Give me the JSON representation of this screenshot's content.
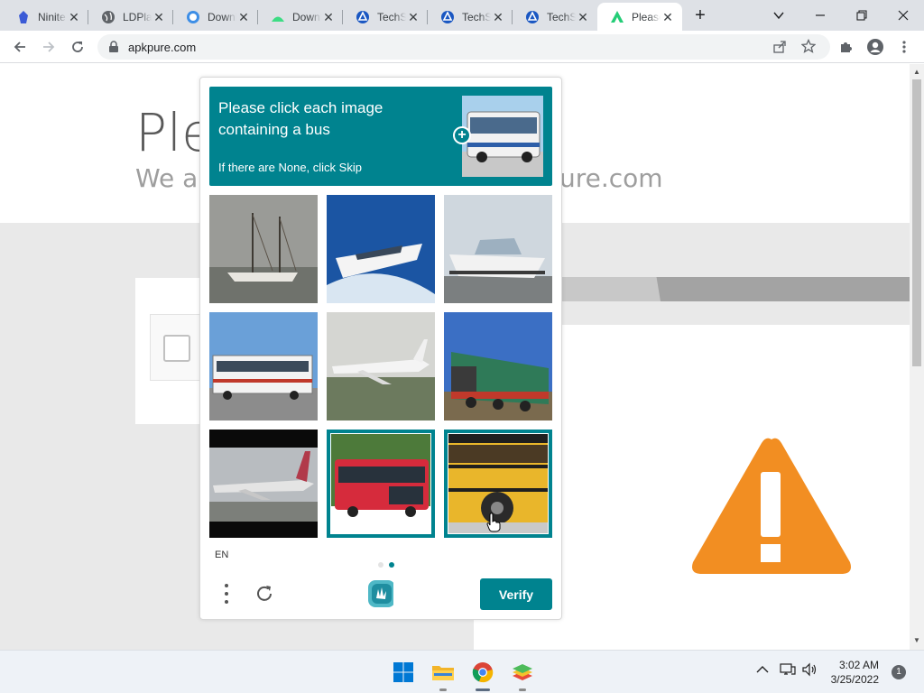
{
  "browser": {
    "tabs": [
      {
        "title": "Ninite",
        "icon": "ninite-icon",
        "active": false
      },
      {
        "title": "LDPlayer",
        "icon": "globe-icon",
        "active": false
      },
      {
        "title": "Download",
        "icon": "download-site-icon",
        "active": false
      },
      {
        "title": "Download",
        "icon": "android-icon",
        "active": false
      },
      {
        "title": "TechSpot",
        "icon": "techspot-icon",
        "active": false
      },
      {
        "title": "TechSpot",
        "icon": "techspot-icon",
        "active": false
      },
      {
        "title": "TechSpot",
        "icon": "techspot-icon",
        "active": false
      },
      {
        "title": "Please",
        "icon": "apkpure-icon",
        "active": true
      }
    ],
    "url": "apkpure.com"
  },
  "page": {
    "heading": "Ple",
    "subtitle_left": "We ar",
    "subtitle_right": "ure.com"
  },
  "captcha": {
    "prompt_line": "Please click each image containing a bus",
    "skip_hint": "If there are None, click Skip",
    "tiles": [
      {
        "subject": "sailboat",
        "selected": false
      },
      {
        "subject": "yacht",
        "selected": false
      },
      {
        "subject": "speedboat",
        "selected": false
      },
      {
        "subject": "bus",
        "selected": false
      },
      {
        "subject": "jet",
        "selected": false
      },
      {
        "subject": "train",
        "selected": false
      },
      {
        "subject": "airliner",
        "selected": false
      },
      {
        "subject": "red-bus",
        "selected": true
      },
      {
        "subject": "school-bus",
        "selected": true
      }
    ],
    "language": "EN",
    "verify_label": "Verify",
    "accent_color": "#00838f"
  },
  "taskbar": {
    "time": "3:02 AM",
    "date": "3/25/2022",
    "notification_count": "1"
  }
}
